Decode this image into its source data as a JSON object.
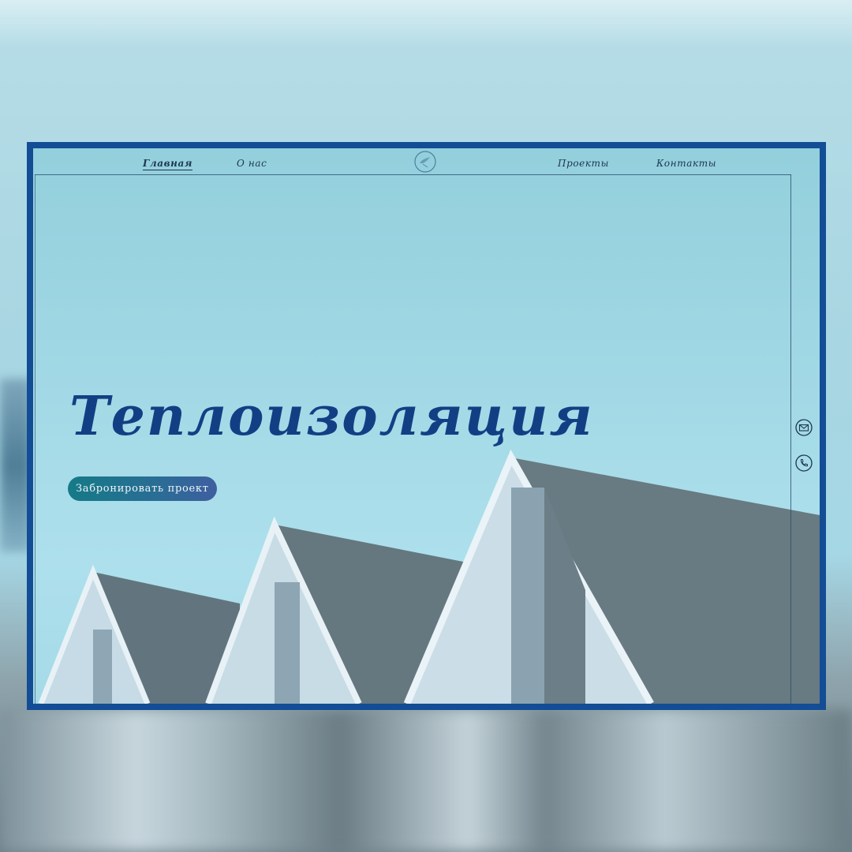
{
  "nav": {
    "items": [
      {
        "label": "Главная",
        "active": true
      },
      {
        "label": "О нас",
        "active": false
      },
      {
        "label": "Проекты",
        "active": false
      },
      {
        "label": "Контакты",
        "active": false
      }
    ],
    "logo_icon": "bird-circle-logo"
  },
  "hero": {
    "title": "Теплоизоляция",
    "cta_label": "Забронировать проект"
  },
  "side_icons": [
    "envelope-icon",
    "phone-icon"
  ],
  "colors": {
    "frame": "#124d95",
    "title": "#123f84",
    "sky": "#a3d9e6",
    "button_start": "#157a87",
    "button_end": "#3f5fa0"
  }
}
